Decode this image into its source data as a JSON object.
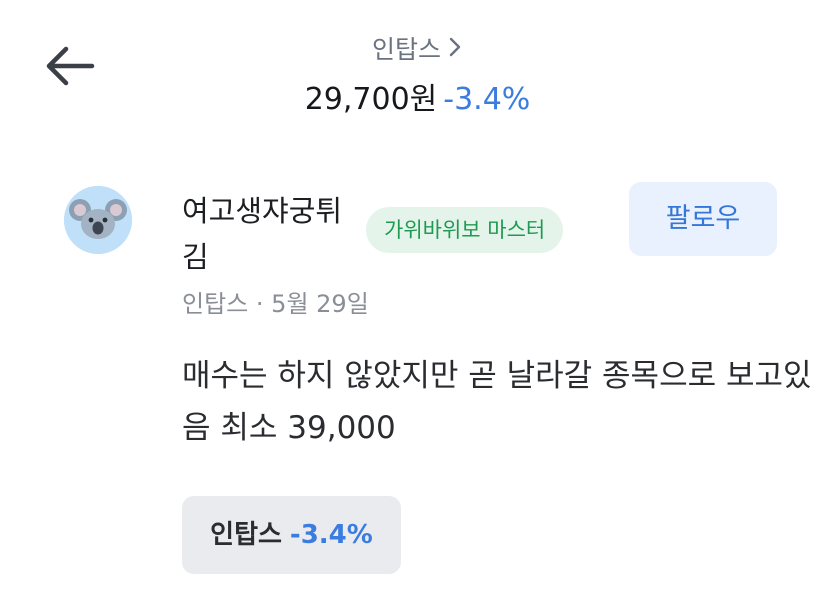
{
  "header": {
    "stock_name": "인탑스",
    "price": "29,700원",
    "change": "-3.4%",
    "back_icon": "arrow-left-icon",
    "chevron_icon": "chevron-right-icon"
  },
  "post": {
    "avatar_icon": "koala-icon",
    "author_name": "여고생쟈궁튀김",
    "badge": "가위바위보 마스터",
    "follow_label": "팔로우",
    "stock": "인탑스",
    "separator": "·",
    "date": "5월 29일",
    "content": "매수는 하지 않았지만 곧 날라갈 종목으로 보고있음 최소 39,000"
  },
  "chip": {
    "stock": "인탑스",
    "change": "-3.4%"
  },
  "colors": {
    "accent_blue": "#3a7ce0",
    "badge_green": "#1f9a53",
    "badge_bg": "#e5f4ea",
    "follow_bg": "#e8f1fd",
    "chip_bg": "#e9ebee"
  }
}
